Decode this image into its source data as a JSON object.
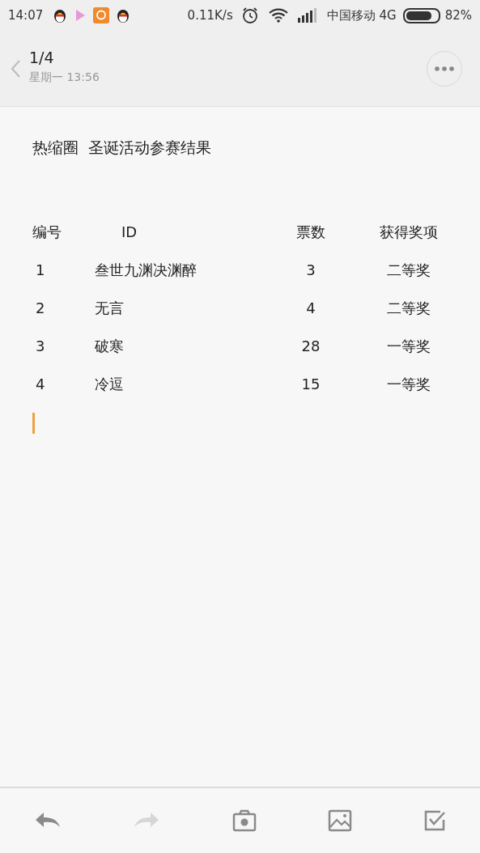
{
  "status_bar": {
    "time": "14:07",
    "speed": "0.11K/s",
    "carrier": "中国移动 4G",
    "battery": "82%"
  },
  "header": {
    "page": "1/4",
    "date": "星期一 13:56"
  },
  "note": {
    "title": "热缩圈  圣诞活动参赛结果",
    "table": {
      "columns": [
        "编号",
        "ID",
        "票数",
        "获得奖项"
      ],
      "rows": [
        {
          "cells": [
            "1",
            "叁世九渊决渊醉",
            "3",
            "二等奖"
          ]
        },
        {
          "cells": [
            "2",
            "无言",
            "4",
            "二等奖"
          ]
        },
        {
          "cells": [
            "3",
            "破寒",
            "28",
            "一等奖"
          ]
        },
        {
          "cells": [
            "4",
            "冷逗",
            "15",
            "一等奖"
          ]
        }
      ]
    }
  },
  "toolbar": [
    {
      "kind": "undo",
      "disabled": false
    },
    {
      "kind": "redo",
      "disabled": true
    },
    {
      "kind": "camera",
      "disabled": false
    },
    {
      "kind": "image",
      "disabled": false
    },
    {
      "kind": "checklist",
      "disabled": false
    }
  ]
}
